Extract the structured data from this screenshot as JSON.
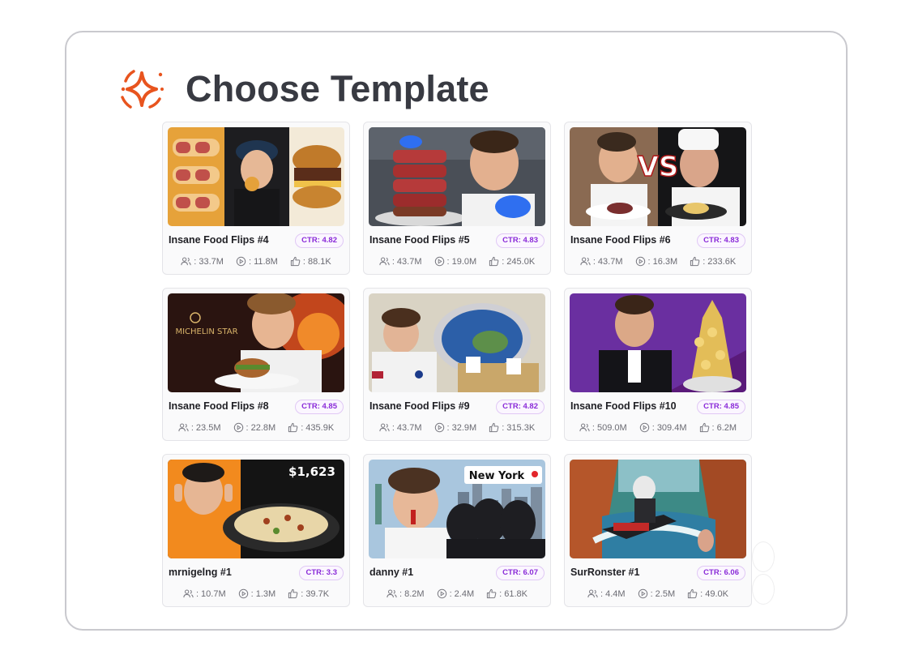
{
  "heading": {
    "title": "Choose Template",
    "icon": "sparkle-icon",
    "accent": "#e8541e"
  },
  "colors": {
    "ctr_text": "#8a2ad8",
    "ctr_border": "#e0c8f5",
    "title": "#383a42"
  },
  "cards": [
    {
      "title": "Insane Food Flips #4",
      "ctr": "CTR: 4.82",
      "subscribers": ": 33.7M",
      "views": ": 11.8M",
      "likes": ": 88.1K",
      "thumbnail_text": ""
    },
    {
      "title": "Insane Food Flips #5",
      "ctr": "CTR: 4.83",
      "subscribers": ": 43.7M",
      "views": ": 19.0M",
      "likes": ": 245.0K",
      "thumbnail_text": ""
    },
    {
      "title": "Insane Food Flips #6",
      "ctr": "CTR: 4.83",
      "subscribers": ": 43.7M",
      "views": ": 16.3M",
      "likes": ": 233.6K",
      "thumbnail_text": "VS"
    },
    {
      "title": "Insane Food Flips #8",
      "ctr": "CTR: 4.85",
      "subscribers": ": 23.5M",
      "views": ": 22.8M",
      "likes": ": 435.9K",
      "thumbnail_text": "MICHELIN STAR"
    },
    {
      "title": "Insane Food Flips #9",
      "ctr": "CTR: 4.82",
      "subscribers": ": 43.7M",
      "views": ": 32.9M",
      "likes": ": 315.3K",
      "thumbnail_text": ""
    },
    {
      "title": "Insane Food Flips #10",
      "ctr": "CTR: 4.85",
      "subscribers": ": 509.0M",
      "views": ": 309.4M",
      "likes": ": 6.2M",
      "thumbnail_text": ""
    },
    {
      "title": "mrnigelng #1",
      "ctr": "CTR: 3.3",
      "subscribers": ": 10.7M",
      "views": ": 1.3M",
      "likes": ": 39.7K",
      "thumbnail_text": "$1,623"
    },
    {
      "title": "danny #1",
      "ctr": "CTR: 6.07",
      "subscribers": ": 8.2M",
      "views": ": 2.4M",
      "likes": ": 61.8K",
      "thumbnail_text": "New York"
    },
    {
      "title": "SurRonster #1",
      "ctr": "CTR: 6.06",
      "subscribers": ": 4.4M",
      "views": ": 2.5M",
      "likes": ": 49.0K",
      "thumbnail_text": ""
    }
  ]
}
